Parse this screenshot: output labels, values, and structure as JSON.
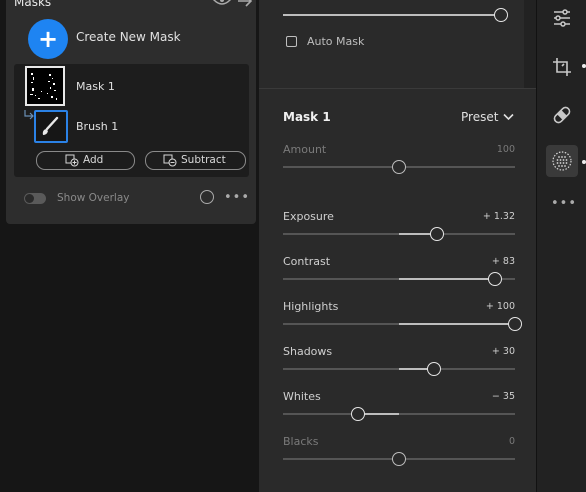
{
  "masks_panel": {
    "title": "Masks",
    "create_label": "Create New Mask",
    "create_symbol": "+",
    "items": [
      {
        "label": "Mask 1"
      },
      {
        "label": "Brush 1"
      }
    ],
    "add_label": "Add",
    "subtract_label": "Subtract",
    "overlay_label": "Show Overlay",
    "more_symbol": "•••"
  },
  "top_section": {
    "auto_mask_label": "Auto Mask",
    "slider_value": 100
  },
  "mask_section": {
    "title": "Mask 1",
    "preset_label": "Preset",
    "sliders": [
      {
        "label": "Amount",
        "value_text": "100",
        "value": 100,
        "min": 0,
        "max": 200,
        "center": 100,
        "enabled": false
      },
      {
        "label": "Exposure",
        "value_text": "+ 1.32",
        "value": 1.32,
        "min": -4,
        "max": 4,
        "center": 0,
        "enabled": true
      },
      {
        "label": "Contrast",
        "value_text": "+ 83",
        "value": 83,
        "min": -100,
        "max": 100,
        "center": 0,
        "enabled": true
      },
      {
        "label": "Highlights",
        "value_text": "+ 100",
        "value": 100,
        "min": -100,
        "max": 100,
        "center": 0,
        "enabled": true
      },
      {
        "label": "Shadows",
        "value_text": "+ 30",
        "value": 30,
        "min": -100,
        "max": 100,
        "center": 0,
        "enabled": true
      },
      {
        "label": "Whites",
        "value_text": "− 35",
        "value": -35,
        "min": -100,
        "max": 100,
        "center": 0,
        "enabled": true
      },
      {
        "label": "Blacks",
        "value_text": "0",
        "value": 0,
        "min": -100,
        "max": 100,
        "center": 0,
        "enabled": false
      }
    ]
  },
  "tool_strip": {
    "tools": [
      "sliders-icon",
      "crop-icon",
      "healing-icon",
      "masking-icon"
    ],
    "active_tool": "masking-icon",
    "more_symbol": "•••"
  },
  "colors": {
    "accent_blue": "#1e84f2",
    "panel_bg": "#2a2a2a",
    "canvas_bg": "#161616"
  }
}
